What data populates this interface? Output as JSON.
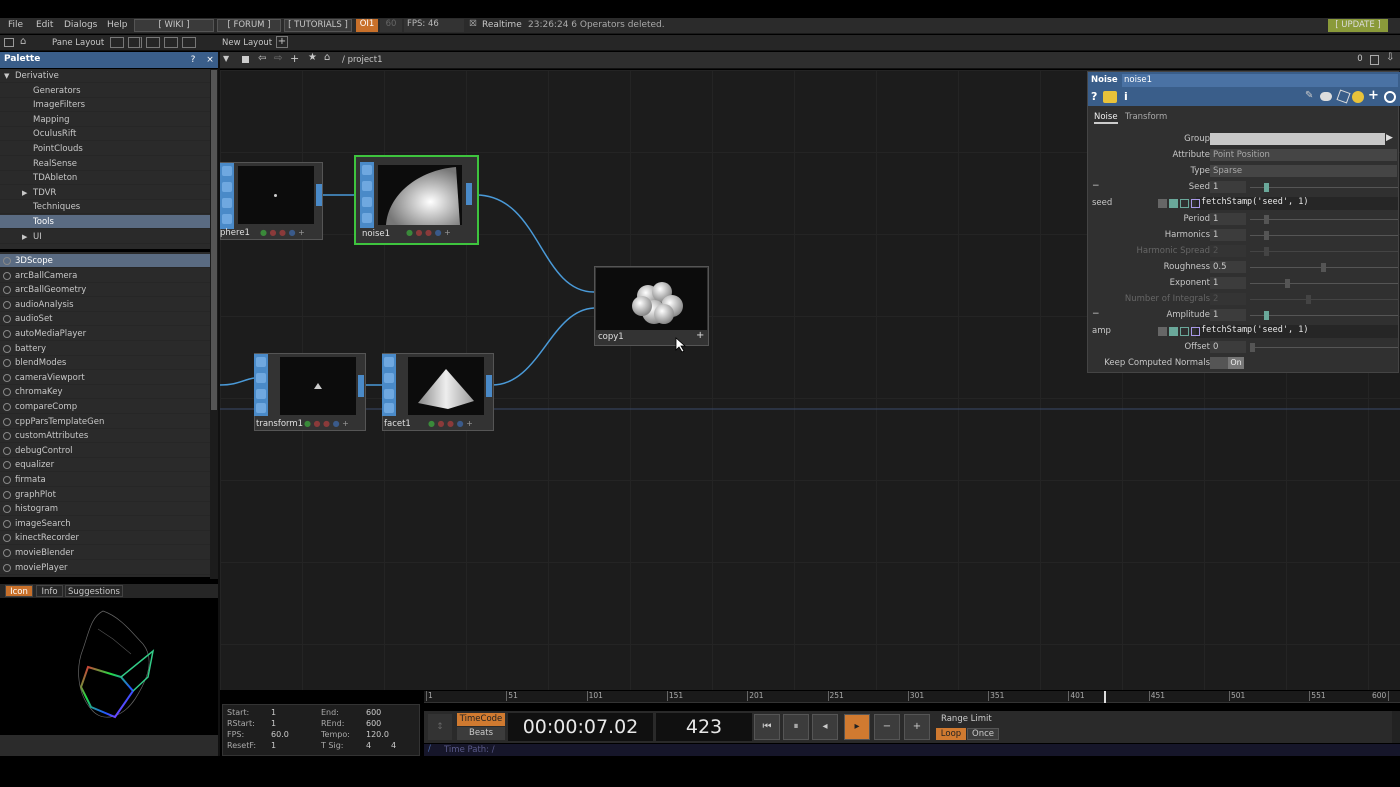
{
  "menubar": {
    "items": [
      "File",
      "Edit",
      "Dialogs",
      "Help"
    ],
    "links": [
      "[ WIKI ]",
      "[ FORUM ]",
      "[ TUTORIALS ]"
    ],
    "ol_badge": "OI1",
    "sixty": "60",
    "fps": "FPS:  46",
    "realtime": "Realtime",
    "status": "23:26:24 6 Operators deleted.",
    "update": "[ UPDATE ]"
  },
  "toolbar2": {
    "pane_layout": "Pane Layout",
    "new_layout": "New Layout"
  },
  "palette": {
    "title": "Palette",
    "help": "?",
    "close": "×",
    "tree": [
      {
        "label": "Derivative",
        "indent": 0,
        "arrow": "▼"
      },
      {
        "label": "Generators",
        "indent": 1,
        "arrow": ""
      },
      {
        "label": "ImageFilters",
        "indent": 1,
        "arrow": ""
      },
      {
        "label": "Mapping",
        "indent": 1,
        "arrow": ""
      },
      {
        "label": "OculusRift",
        "indent": 1,
        "arrow": ""
      },
      {
        "label": "PointClouds",
        "indent": 1,
        "arrow": ""
      },
      {
        "label": "RealSense",
        "indent": 1,
        "arrow": ""
      },
      {
        "label": "TDAbleton",
        "indent": 1,
        "arrow": ""
      },
      {
        "label": "TDVR",
        "indent": 1,
        "arrow": "▶"
      },
      {
        "label": "Techniques",
        "indent": 1,
        "arrow": ""
      },
      {
        "label": "Tools",
        "indent": 1,
        "arrow": ""
      },
      {
        "label": "UI",
        "indent": 1,
        "arrow": "▶"
      }
    ],
    "selected_tree": "Tools",
    "list": [
      "3DScope",
      "arcBallCamera",
      "arcBallGeometry",
      "audioAnalysis",
      "audioSet",
      "autoMediaPlayer",
      "battery",
      "blendModes",
      "cameraViewport",
      "chromaKey",
      "compareComp",
      "cppParsTemplateGen",
      "customAttributes",
      "debugControl",
      "equalizer",
      "firmata",
      "graphPlot",
      "histogram",
      "imageSearch",
      "kinectRecorder",
      "movieBlender",
      "moviePlayer"
    ],
    "selected_list": "3DScope",
    "preview_tabs": [
      "Icon",
      "Info",
      "Suggestions"
    ],
    "active_preview_tab": "Icon"
  },
  "network": {
    "path": "/ project1",
    "counter": "0",
    "nodes": {
      "sphere": "phere1",
      "noise": "noise1",
      "copy": "copy1",
      "transform": "transform1",
      "facet": "facet1"
    }
  },
  "params": {
    "op_type": "Noise",
    "op_name": "noise1",
    "tabs": [
      "Noise",
      "Transform"
    ],
    "active_tab": "Noise",
    "group_label": "Group",
    "attribute_label": "Attribute",
    "attribute_value": "Point Position",
    "type_label": "Type",
    "type_value": "Sparse",
    "seed_label": "Seed",
    "seed_value": "1",
    "seed_expr_name": "seed",
    "seed_expr": "fetchStamp('seed', 1)",
    "period_label": "Period",
    "period_value": "1",
    "harmonics_label": "Harmonics",
    "harmonics_value": "1",
    "harmonic_spread_label": "Harmonic Spread",
    "harmonic_spread_value": "2",
    "roughness_label": "Roughness",
    "roughness_value": "0.5",
    "exponent_label": "Exponent",
    "exponent_value": "1",
    "integrals_label": "Number of Integrals",
    "integrals_value": "2",
    "amplitude_label": "Amplitude",
    "amplitude_value": "1",
    "amp_expr_name": "amp",
    "amp_expr": "fetchStamp('seed', 1)",
    "offset_label": "Offset",
    "offset_value": "0",
    "normals_label": "Keep Computed Normals",
    "normals_value": "On"
  },
  "timeline": {
    "ticks": [
      "1",
      "51",
      "101",
      "151",
      "201",
      "251",
      "301",
      "351",
      "401",
      "451",
      "501",
      "551",
      "600"
    ],
    "current_frame_marker": 423,
    "start_label": "Start:",
    "start_value": "1",
    "end_label": "End:",
    "end_value": "600",
    "rstart_label": "RStart:",
    "rstart_value": "1",
    "rend_label": "REnd:",
    "rend_value": "600",
    "fps_label": "FPS:",
    "fps_value": "60.0",
    "tempo_label": "Tempo:",
    "tempo_value": "120.0",
    "resetf_label": "ResetF:",
    "resetf_value": "1",
    "tsig_label": "T Sig:",
    "tsig_value_a": "4",
    "tsig_value_b": "4",
    "timecode_btn": "TimeCode",
    "beats_btn": "Beats",
    "timecode": "00:00:07.02",
    "frame": "423",
    "range_limit": "Range Limit",
    "loop": "Loop",
    "once": "Once",
    "time_path": "Time Path: /"
  },
  "colors": {
    "accent_blue": "#3a5e8a",
    "node_selected": "#3ec43e",
    "wire": "#4a9ad8",
    "orange": "#d07a30"
  }
}
